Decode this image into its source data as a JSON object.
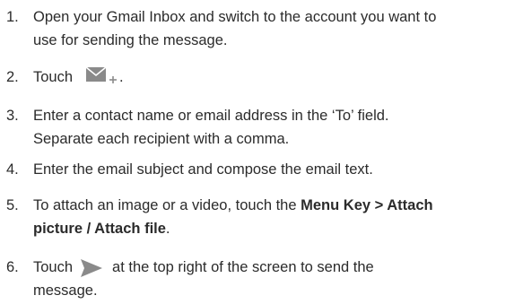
{
  "steps": [
    {
      "number": "1.",
      "line1": "Open your Gmail Inbox and switch to the account you want to",
      "line2": "use for sending the message."
    },
    {
      "number": "2.",
      "before": "Touch",
      "after": ".",
      "icon": "compose-mail-icon"
    },
    {
      "number": "3.",
      "line1": "Enter a contact name or email address in the ‘To’ field.",
      "line2": "Separate each recipient with a comma."
    },
    {
      "number": "4.",
      "line1": "Enter the email subject and compose the email text."
    },
    {
      "number": "5.",
      "before": "To attach an image or a video, touch the ",
      "bold1": "Menu Key > Attach",
      "bold2": "picture / Attach file",
      "after": "."
    },
    {
      "number": "6.",
      "before": "Touch",
      "after": "at the top right of the screen to send the",
      "line2": "message.",
      "icon": "send-icon"
    }
  ],
  "colors": {
    "text": "#2b2b2b",
    "icon": "#8a8a8a"
  }
}
